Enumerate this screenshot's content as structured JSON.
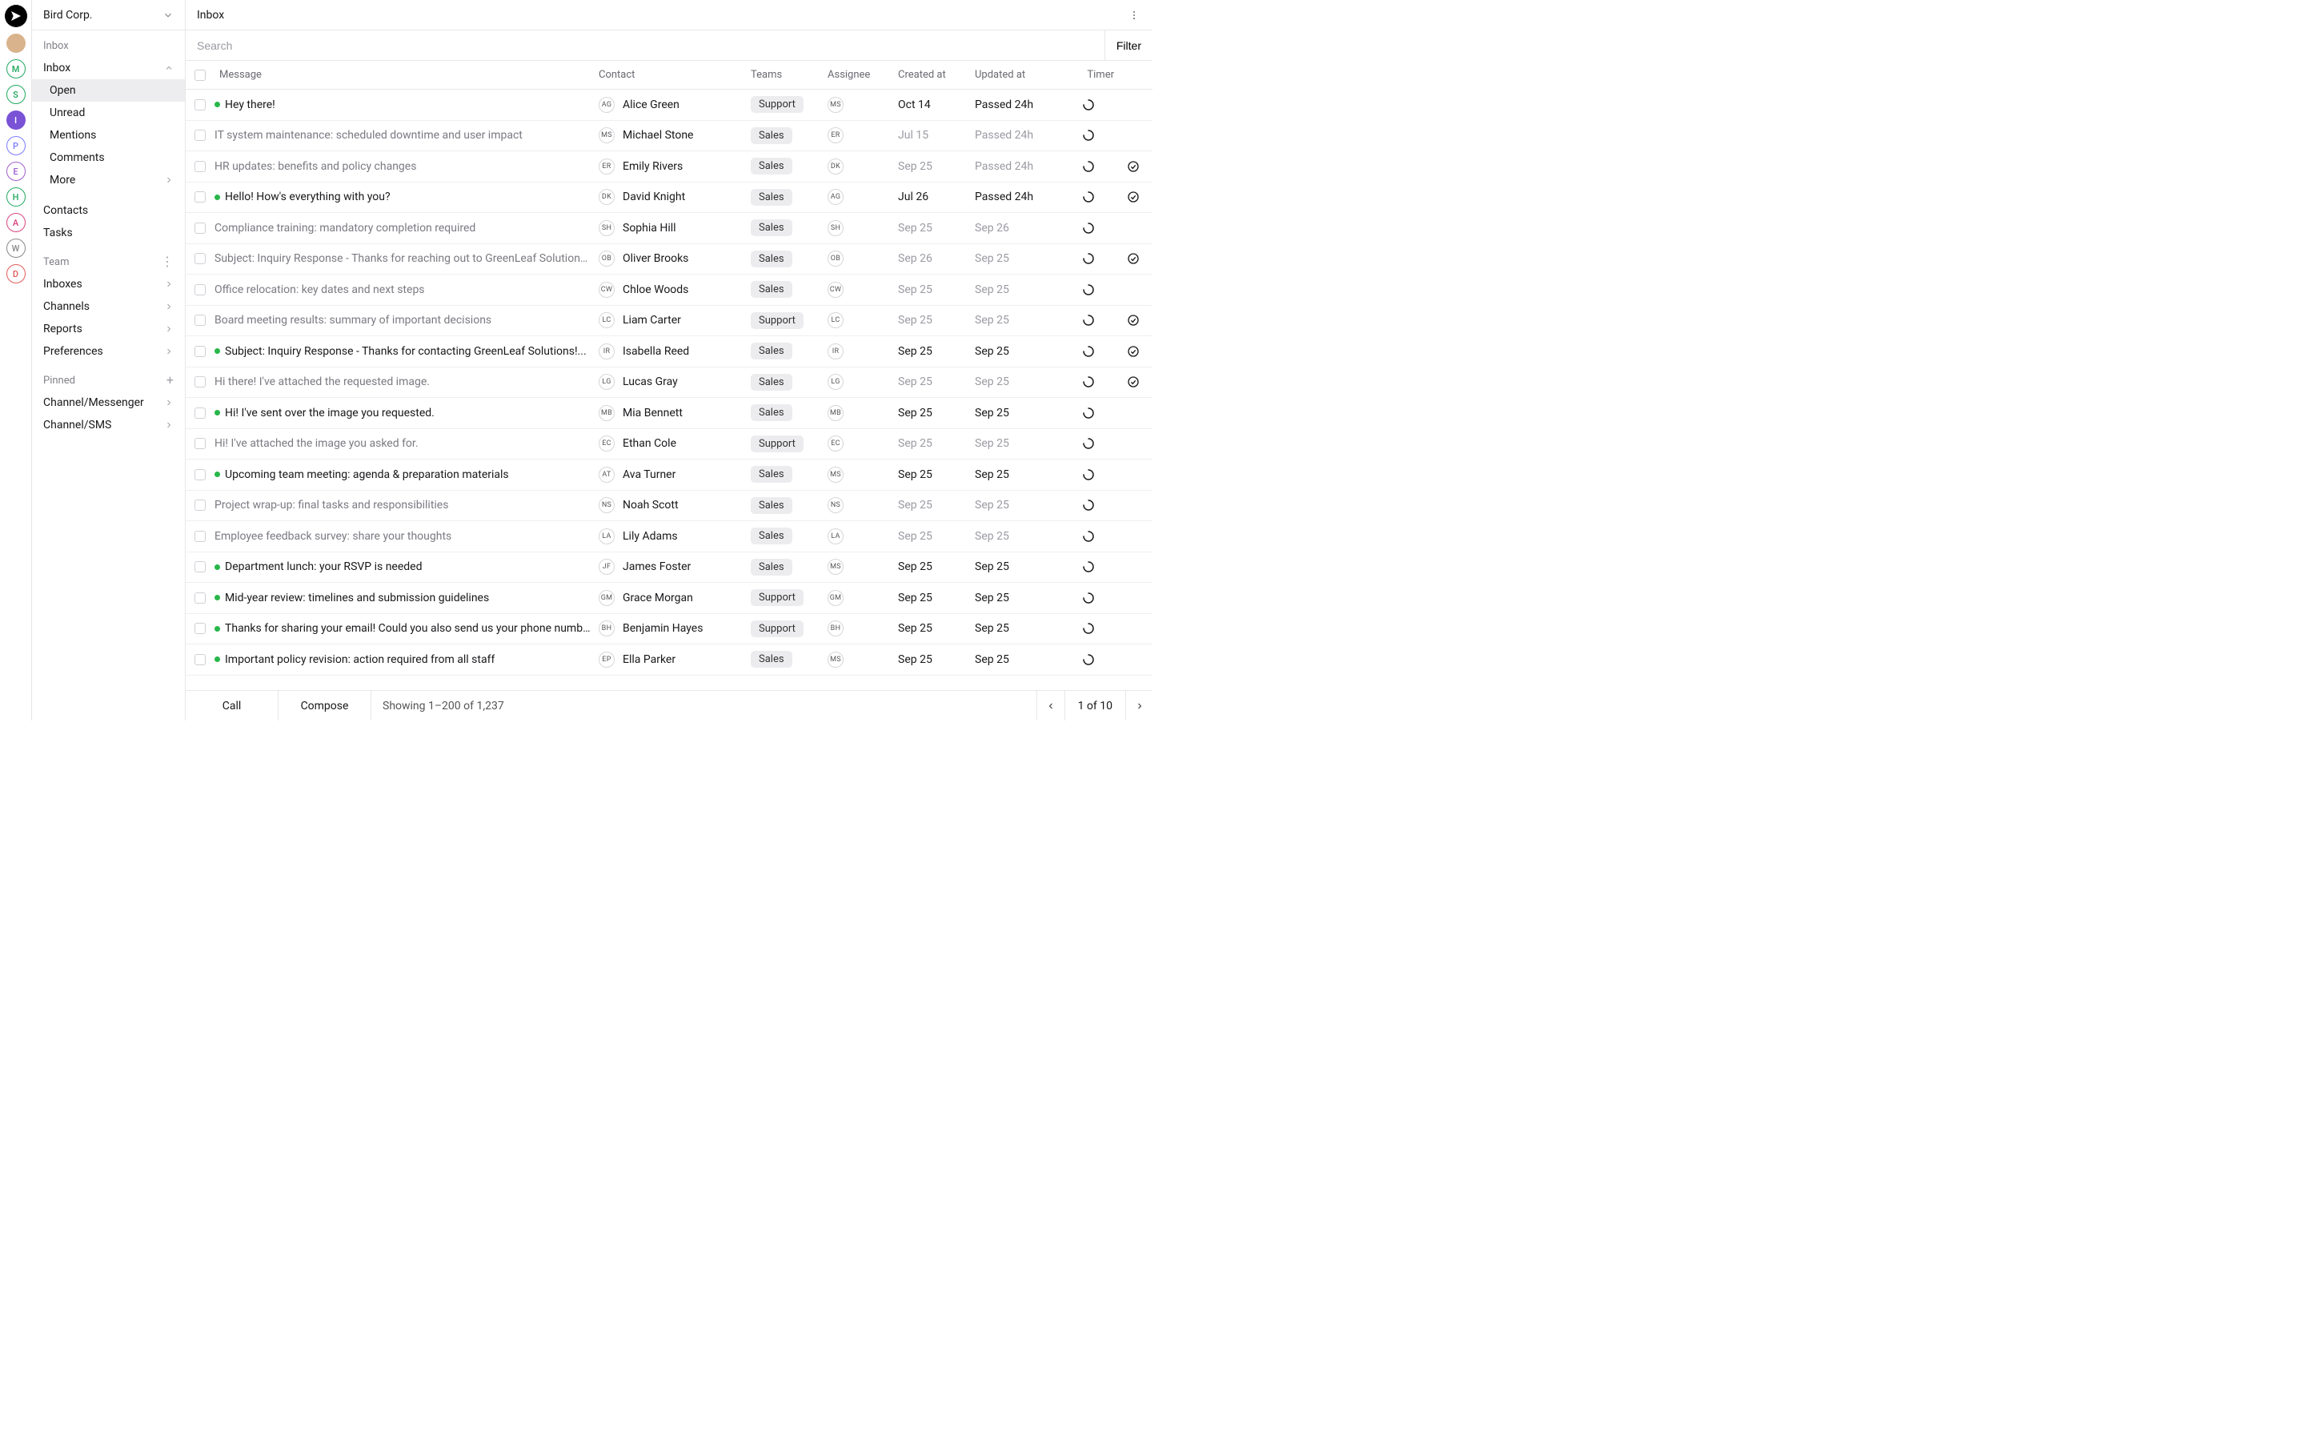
{
  "org": {
    "name": "Bird Corp."
  },
  "rail": [
    {
      "letter": "M",
      "cls": "rc-M"
    },
    {
      "letter": "S",
      "cls": "rc-S"
    },
    {
      "letter": "I",
      "cls": "rc-I"
    },
    {
      "letter": "P",
      "cls": "rc-P"
    },
    {
      "letter": "E",
      "cls": "rc-E"
    },
    {
      "letter": "H",
      "cls": "rc-H"
    },
    {
      "letter": "A",
      "cls": "rc-A"
    },
    {
      "letter": "W",
      "cls": "rc-W"
    },
    {
      "letter": "D",
      "cls": "rc-D"
    }
  ],
  "sidebar": {
    "nav_title": "Inbox",
    "inbox_label": "Inbox",
    "items": [
      "Open",
      "Unread",
      "Mentions",
      "Comments",
      "More"
    ],
    "contacts": "Contacts",
    "tasks": "Tasks",
    "team_header": "Team",
    "team_items": [
      "Inboxes",
      "Channels",
      "Reports",
      "Preferences"
    ],
    "pinned_header": "Pinned",
    "pinned_items": [
      "Channel/Messenger",
      "Channel/SMS"
    ]
  },
  "header": {
    "title": "Inbox"
  },
  "search": {
    "placeholder": "Search",
    "filter": "Filter"
  },
  "columns": {
    "message": "Message",
    "contact": "Contact",
    "teams": "Teams",
    "assignee": "Assignee",
    "created": "Created at",
    "updated": "Updated at",
    "timer": "Timer"
  },
  "rows": [
    {
      "unread": true,
      "msg": "Hey there!",
      "ci": "AG",
      "contact": "Alice Green",
      "team": "Support",
      "ai": "MS",
      "created": "Oct 14",
      "updated": "Passed 24h",
      "check": false
    },
    {
      "unread": false,
      "msg": "IT system maintenance: scheduled downtime and user impact",
      "ci": "MS",
      "contact": "Michael Stone",
      "team": "Sales",
      "ai": "ER",
      "created": "Jul 15",
      "updated": "Passed 24h",
      "check": false
    },
    {
      "unread": false,
      "msg": "HR updates: benefits and policy changes",
      "ci": "ER",
      "contact": "Emily Rivers",
      "team": "Sales",
      "ai": "DK",
      "created": "Sep 25",
      "updated": "Passed 24h",
      "check": true
    },
    {
      "unread": true,
      "msg": "Hello! How's everything with you?",
      "ci": "DK",
      "contact": "David Knight",
      "team": "Sales",
      "ai": "AG",
      "created": "Jul 26",
      "updated": "Passed 24h",
      "check": true
    },
    {
      "unread": false,
      "msg": "Compliance training: mandatory completion required",
      "ci": "SH",
      "contact": "Sophia Hill",
      "team": "Sales",
      "ai": "SH",
      "created": "Sep 25",
      "updated": "Sep 26",
      "check": false
    },
    {
      "unread": false,
      "msg": "Subject: Inquiry Response - Thanks for reaching out to GreenLeaf Solutions...",
      "ci": "OB",
      "contact": "Oliver Brooks",
      "team": "Sales",
      "ai": "OB",
      "created": "Sep 26",
      "updated": "Sep 25",
      "check": true
    },
    {
      "unread": false,
      "msg": "Office relocation: key dates and next steps",
      "ci": "CW",
      "contact": "Chloe Woods",
      "team": "Sales",
      "ai": "CW",
      "created": "Sep 25",
      "updated": "Sep 25",
      "check": false
    },
    {
      "unread": false,
      "msg": "Board meeting results: summary of important decisions",
      "ci": "LC",
      "contact": "Liam Carter",
      "team": "Support",
      "ai": "LC",
      "created": "Sep 25",
      "updated": "Sep 25",
      "check": true
    },
    {
      "unread": true,
      "msg": "Subject: Inquiry Response - Thanks for contacting GreenLeaf Solutions!...",
      "ci": "IR",
      "contact": "Isabella Reed",
      "team": "Sales",
      "ai": "IR",
      "created": "Sep 25",
      "updated": "Sep 25",
      "check": true
    },
    {
      "unread": false,
      "msg": "Hi there! I've attached the requested image.",
      "ci": "LG",
      "contact": "Lucas Gray",
      "team": "Sales",
      "ai": "LG",
      "created": "Sep 25",
      "updated": "Sep 25",
      "check": true
    },
    {
      "unread": true,
      "msg": "Hi! I've sent over the image you requested.",
      "ci": "MB",
      "contact": "Mia Bennett",
      "team": "Sales",
      "ai": "MB",
      "created": "Sep 25",
      "updated": "Sep 25",
      "check": false
    },
    {
      "unread": false,
      "msg": "Hi! I've attached the image you asked for.",
      "ci": "EC",
      "contact": "Ethan Cole",
      "team": "Support",
      "ai": "EC",
      "created": "Sep 25",
      "updated": "Sep 25",
      "check": false
    },
    {
      "unread": true,
      "msg": "Upcoming team meeting: agenda & preparation materials",
      "ci": "AT",
      "contact": "Ava Turner",
      "team": "Sales",
      "ai": "MS",
      "created": "Sep 25",
      "updated": "Sep 25",
      "check": false
    },
    {
      "unread": false,
      "msg": "Project wrap-up: final tasks and responsibilities",
      "ci": "NS",
      "contact": "Noah Scott",
      "team": "Sales",
      "ai": "NS",
      "created": "Sep 25",
      "updated": "Sep 25",
      "check": false
    },
    {
      "unread": false,
      "msg": "Employee feedback survey: share your thoughts",
      "ci": "LA",
      "contact": "Lily Adams",
      "team": "Sales",
      "ai": "LA",
      "created": "Sep 25",
      "updated": "Sep 25",
      "check": false
    },
    {
      "unread": true,
      "msg": "Department lunch: your RSVP is needed",
      "ci": "JF",
      "contact": "James Foster",
      "team": "Sales",
      "ai": "MS",
      "created": "Sep 25",
      "updated": "Sep 25",
      "check": false
    },
    {
      "unread": true,
      "msg": "Mid-year review: timelines and submission guidelines",
      "ci": "GM",
      "contact": "Grace Morgan",
      "team": "Support",
      "ai": "GM",
      "created": "Sep 25",
      "updated": "Sep 25",
      "check": false
    },
    {
      "unread": true,
      "msg": "Thanks for sharing your email! Could you also send us your phone numbe...",
      "ci": "BH",
      "contact": "Benjamin Hayes",
      "team": "Support",
      "ai": "BH",
      "created": "Sep 25",
      "updated": "Sep 25",
      "check": false
    },
    {
      "unread": true,
      "msg": "Important policy revision: action required from all staff",
      "ci": "EP",
      "contact": "Ella Parker",
      "team": "Sales",
      "ai": "MS",
      "created": "Sep 25",
      "updated": "Sep 25",
      "check": false
    }
  ],
  "footer": {
    "call": "Call",
    "compose": "Compose",
    "status": "Showing 1–200 of 1,237",
    "page": "1 of 10"
  }
}
